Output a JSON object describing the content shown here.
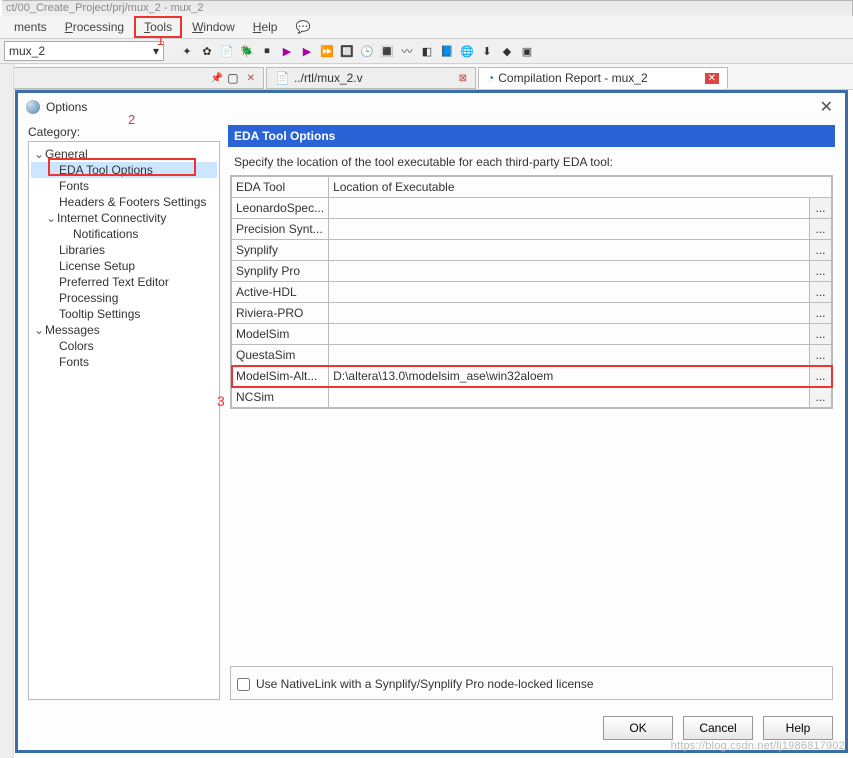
{
  "window": {
    "title_fragment": "ct/00_Create_Project/prj/mux_2 - mux_2"
  },
  "menubar": {
    "items": [
      "ments",
      "Processing",
      "Tools",
      "Window",
      "Help"
    ]
  },
  "toolbar": {
    "combo_value": "mux_2"
  },
  "tabs": [
    {
      "label": "",
      "pinnable": true
    },
    {
      "label": "../rtl/mux_2.v",
      "closable": true
    },
    {
      "label": "Compilation Report - mux_2",
      "closable": true
    }
  ],
  "annotations": {
    "one": "1",
    "two": "2",
    "three": "3"
  },
  "dialog": {
    "title": "Options",
    "close": "✕",
    "category_label": "Category:",
    "tree": {
      "general": "General",
      "eda": "EDA Tool Options",
      "fonts": "Fonts",
      "headers": "Headers & Footers Settings",
      "internet": "Internet Connectivity",
      "notifications": "Notifications",
      "libraries": "Libraries",
      "license": "License Setup",
      "texteditor": "Preferred Text Editor",
      "processing": "Processing",
      "tooltip": "Tooltip Settings",
      "messages": "Messages",
      "msg_colors": "Colors",
      "msg_fonts": "Fonts"
    },
    "panel": {
      "heading": "EDA Tool Options",
      "description": "Specify the location of the tool executable for each third-party EDA tool:",
      "columns": {
        "tool": "EDA Tool",
        "location": "Location of Executable"
      },
      "rows": [
        {
          "tool": "LeonardoSpec...",
          "location": ""
        },
        {
          "tool": "Precision Synt...",
          "location": ""
        },
        {
          "tool": "Synplify",
          "location": ""
        },
        {
          "tool": "Synplify Pro",
          "location": ""
        },
        {
          "tool": "Active-HDL",
          "location": ""
        },
        {
          "tool": "Riviera-PRO",
          "location": ""
        },
        {
          "tool": "ModelSim",
          "location": ""
        },
        {
          "tool": "QuestaSim",
          "location": ""
        },
        {
          "tool": "ModelSim-Alt...",
          "location": "D:\\altera\\13.0\\modelsim_ase\\win32aloem"
        },
        {
          "tool": "NCSim",
          "location": ""
        }
      ],
      "browse": "...",
      "checkbox_label": "Use NativeLink with a Synplify/Synplify Pro node-locked license"
    },
    "buttons": {
      "ok": "OK",
      "cancel": "Cancel",
      "help": "Help"
    }
  },
  "watermark": "https://blog.csdn.net/lj1986817902"
}
